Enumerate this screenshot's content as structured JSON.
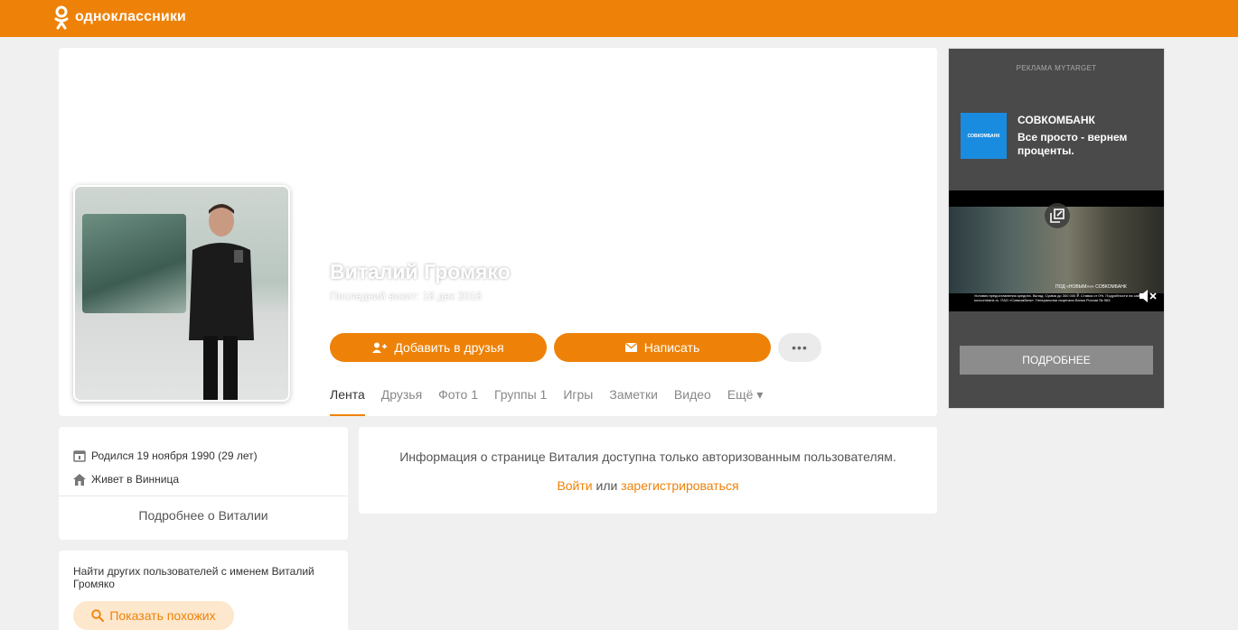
{
  "header": {
    "logo_text": "одноклассники",
    "accent_color": "#ee8208",
    "logo_icon": "ok-logo-icon"
  },
  "profile": {
    "name": "Виталий Громяко",
    "last_visit": "Последний визит: 18 дек 2016",
    "add_friend_label": "Добавить в друзья",
    "write_label": "Написать",
    "more_label": "•••"
  },
  "tabs": [
    {
      "label": "Лента",
      "active": true
    },
    {
      "label": "Друзья"
    },
    {
      "label": "Фото 1"
    },
    {
      "label": "Группы 1"
    },
    {
      "label": "Игры"
    },
    {
      "label": "Заметки"
    },
    {
      "label": "Видео"
    },
    {
      "label": "Ещё ▾"
    }
  ],
  "info": {
    "born": "Родился 19 ноября 1990 (29 лет)",
    "lives": "Живет в Винница",
    "more_link": "Подробнее о Виталии"
  },
  "find": {
    "text": "Найти других пользователей с именем Виталий Громяко",
    "button_label": "Показать похожих"
  },
  "notice": {
    "text": "Информация о странице Виталия доступна только авторизованным пользователям.",
    "login_label": "Войти",
    "or_label": " или ",
    "register_label": "зарегистрироваться"
  },
  "ad": {
    "label": "РЕКЛАМА MYTARGET",
    "logo_text": "СОВКОМБАНК",
    "brand": "СОВКОМБАНК",
    "text": "Все просто - вернем проценты.",
    "video_lower": "ПОД «НОВЫМ»»» СОВКОМБАНК",
    "video_caption": "Условия предоставления кредита. Вклад. Сумма до 300 000 ₽. Ставка от 0%. Подробности на сайте sovcombank.ru. ПАО «Совкомбанк». Генеральная лицензия Банка России № 963.",
    "button_label": "ПОДРОБНЕЕ"
  }
}
